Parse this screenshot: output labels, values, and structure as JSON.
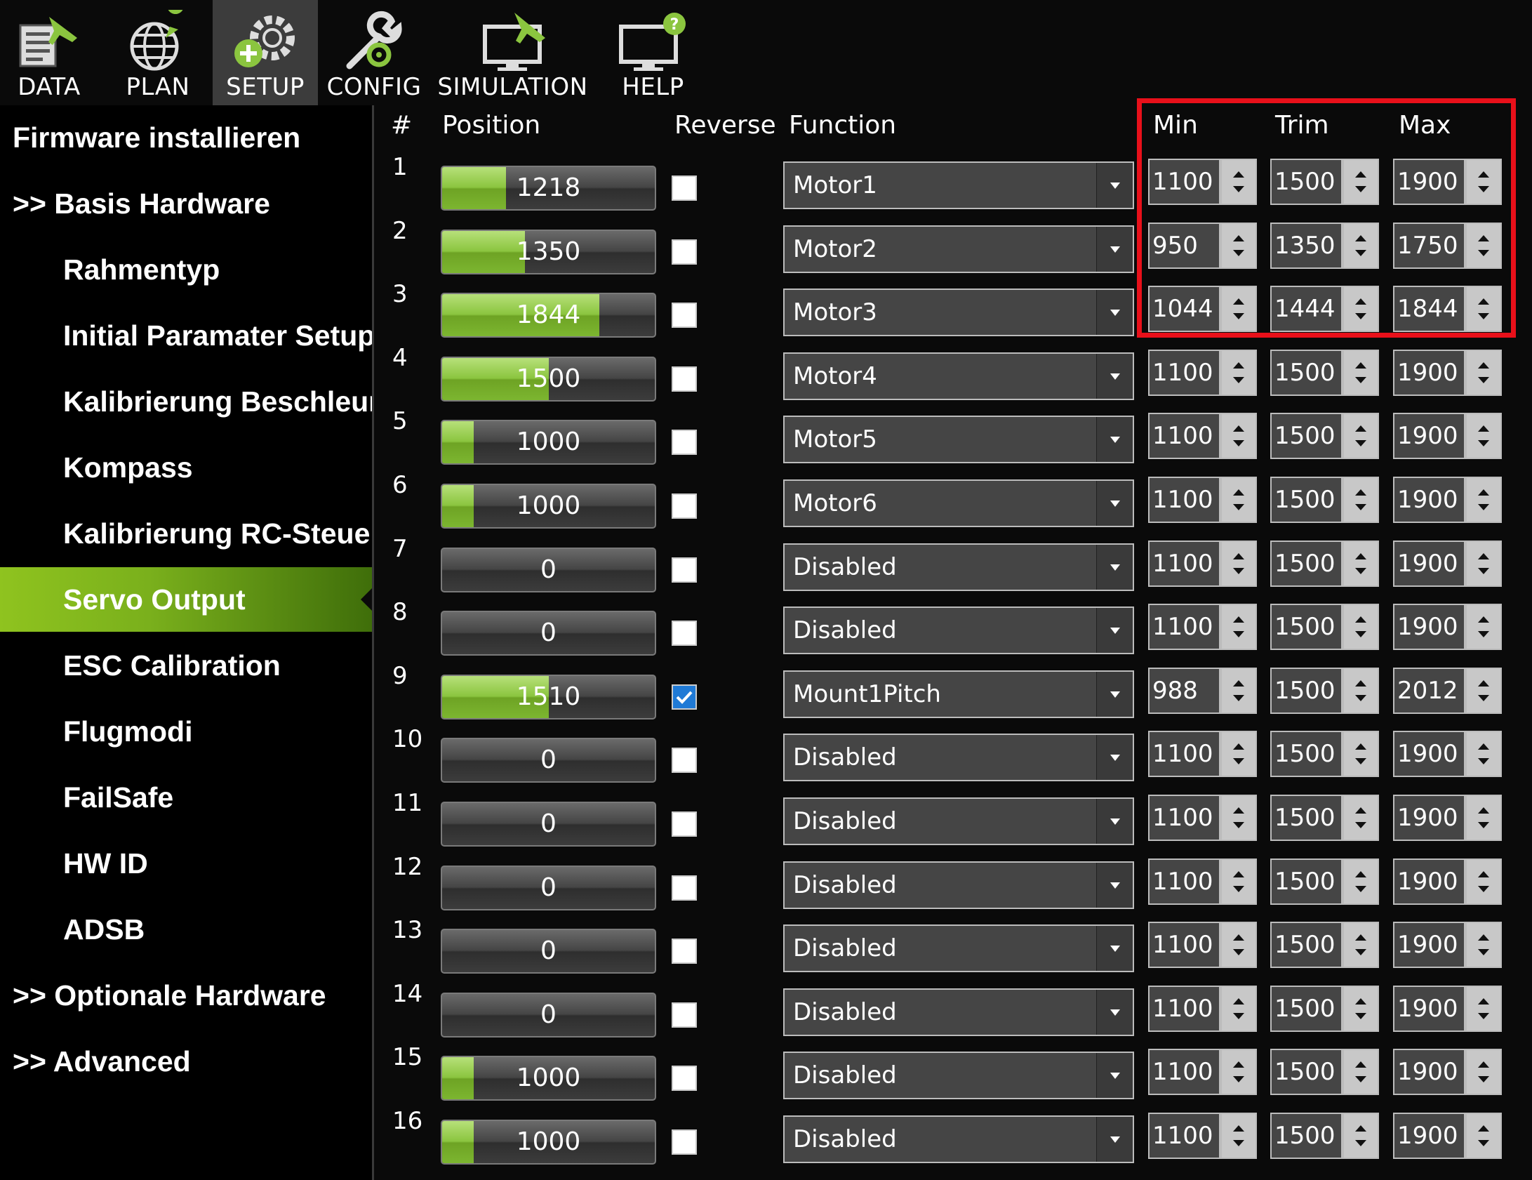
{
  "toolbar": {
    "items": [
      {
        "label": "DATA",
        "icon": "data-icon"
      },
      {
        "label": "PLAN",
        "icon": "globe-icon"
      },
      {
        "label": "SETUP",
        "icon": "setup-gear-icon",
        "active": true
      },
      {
        "label": "CONFIG",
        "icon": "wrench-icon"
      },
      {
        "label": "SIMULATION",
        "icon": "monitor-plane-icon"
      },
      {
        "label": "HELP",
        "icon": "monitor-help-icon"
      }
    ]
  },
  "sidebar": {
    "items": [
      {
        "label": "Firmware installieren"
      },
      {
        "label": ">> Basis Hardware"
      },
      {
        "label": "Rahmentyp"
      },
      {
        "label": "Initial Paramater Setup"
      },
      {
        "label": "Kalibrierung Beschleunigungssensor"
      },
      {
        "label": "Kompass"
      },
      {
        "label": "Kalibrierung RC-Steuerung"
      },
      {
        "label": "Servo Output"
      },
      {
        "label": "ESC Calibration"
      },
      {
        "label": "Flugmodi"
      },
      {
        "label": "FailSafe"
      },
      {
        "label": "HW ID"
      },
      {
        "label": "ADSB"
      },
      {
        "label": ">> Optionale Hardware"
      },
      {
        "label": ">> Advanced"
      }
    ]
  },
  "table": {
    "headers": {
      "num": "#",
      "position": "Position",
      "reverse": "Reverse",
      "function": "Function",
      "min": "Min",
      "trim": "Trim",
      "max": "Max"
    },
    "rows": [
      {
        "num": "1",
        "position": "1218",
        "fill": 0.3,
        "reverse": false,
        "function": "Motor1",
        "min": "1100",
        "trim": "1500",
        "max": "1900"
      },
      {
        "num": "2",
        "position": "1350",
        "fill": 0.39,
        "reverse": false,
        "function": "Motor2",
        "min": "950",
        "trim": "1350",
        "max": "1750"
      },
      {
        "num": "3",
        "position": "1844",
        "fill": 0.74,
        "reverse": false,
        "function": "Motor3",
        "min": "1044",
        "trim": "1444",
        "max": "1844"
      },
      {
        "num": "4",
        "position": "1500",
        "fill": 0.5,
        "reverse": false,
        "function": "Motor4",
        "min": "1100",
        "trim": "1500",
        "max": "1900"
      },
      {
        "num": "5",
        "position": "1000",
        "fill": 0.15,
        "reverse": false,
        "function": "Motor5",
        "min": "1100",
        "trim": "1500",
        "max": "1900"
      },
      {
        "num": "6",
        "position": "1000",
        "fill": 0.15,
        "reverse": false,
        "function": "Motor6",
        "min": "1100",
        "trim": "1500",
        "max": "1900"
      },
      {
        "num": "7",
        "position": "0",
        "fill": 0,
        "reverse": false,
        "function": "Disabled",
        "min": "1100",
        "trim": "1500",
        "max": "1900"
      },
      {
        "num": "8",
        "position": "0",
        "fill": 0,
        "reverse": false,
        "function": "Disabled",
        "min": "1100",
        "trim": "1500",
        "max": "1900"
      },
      {
        "num": "9",
        "position": "1510",
        "fill": 0.5,
        "reverse": true,
        "function": "Mount1Pitch",
        "min": "988",
        "trim": "1500",
        "max": "2012"
      },
      {
        "num": "10",
        "position": "0",
        "fill": 0,
        "reverse": false,
        "function": "Disabled",
        "min": "1100",
        "trim": "1500",
        "max": "1900"
      },
      {
        "num": "11",
        "position": "0",
        "fill": 0,
        "reverse": false,
        "function": "Disabled",
        "min": "1100",
        "trim": "1500",
        "max": "1900"
      },
      {
        "num": "12",
        "position": "0",
        "fill": 0,
        "reverse": false,
        "function": "Disabled",
        "min": "1100",
        "trim": "1500",
        "max": "1900"
      },
      {
        "num": "13",
        "position": "0",
        "fill": 0,
        "reverse": false,
        "function": "Disabled",
        "min": "1100",
        "trim": "1500",
        "max": "1900"
      },
      {
        "num": "14",
        "position": "0",
        "fill": 0,
        "reverse": false,
        "function": "Disabled",
        "min": "1100",
        "trim": "1500",
        "max": "1900"
      },
      {
        "num": "15",
        "position": "1000",
        "fill": 0.15,
        "reverse": false,
        "function": "Disabled",
        "min": "1100",
        "trim": "1500",
        "max": "1900"
      },
      {
        "num": "16",
        "position": "1000",
        "fill": 0.15,
        "reverse": false,
        "function": "Disabled",
        "min": "1100",
        "trim": "1500",
        "max": "1900"
      }
    ]
  },
  "colors": {
    "accent_green": "#8bc53f",
    "highlight_red": "#e8101a",
    "check_blue": "#1f7ad6"
  }
}
